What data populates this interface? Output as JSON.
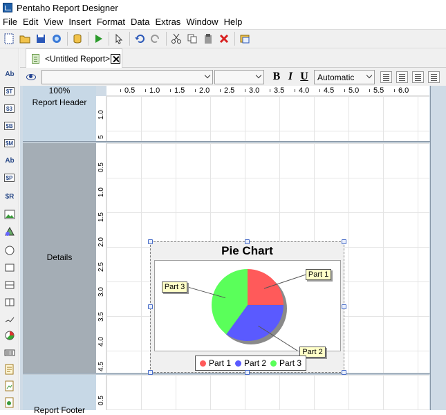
{
  "app": {
    "title": "Pentaho Report Designer"
  },
  "menu": [
    "File",
    "Edit",
    "View",
    "Insert",
    "Format",
    "Data",
    "Extras",
    "Window",
    "Help"
  ],
  "tab": {
    "label": "<Untitled Report>"
  },
  "format": {
    "font_value": "",
    "size_value": "",
    "bold": "B",
    "italic": "I",
    "underline": "U",
    "color_value": "Automatic"
  },
  "zoom": "100%",
  "ruler_h": [
    "0.5",
    "1.0",
    "1.5",
    "2.0",
    "2.5",
    "3.0",
    "3.5",
    "4.0",
    "4.5",
    "5.0",
    "5.5",
    "6.0"
  ],
  "bands": {
    "header": "Report Header",
    "details": "Details",
    "footer": "Report Footer"
  },
  "vruler_header": [
    "1.0",
    "5"
  ],
  "vruler_details": [
    "0.5",
    "1.0",
    "1.5",
    "2.0",
    "2.5",
    "3.0",
    "3.5",
    "4.0",
    "4.5"
  ],
  "vruler_footer": [
    "0.5"
  ],
  "left_palette": [
    "Ab",
    "$T",
    "$3",
    "$B",
    "$M",
    "Ab",
    "$P",
    "$R"
  ],
  "colors": {
    "part1": "#ff5a5a",
    "part2": "#5a5aff",
    "part3": "#5aff5a"
  },
  "chart_data": {
    "type": "pie",
    "title": "Pie Chart",
    "categories": [
      "Part 1",
      "Part 2",
      "Part 3"
    ],
    "values": [
      25,
      35,
      40
    ],
    "legend": "bottom"
  }
}
